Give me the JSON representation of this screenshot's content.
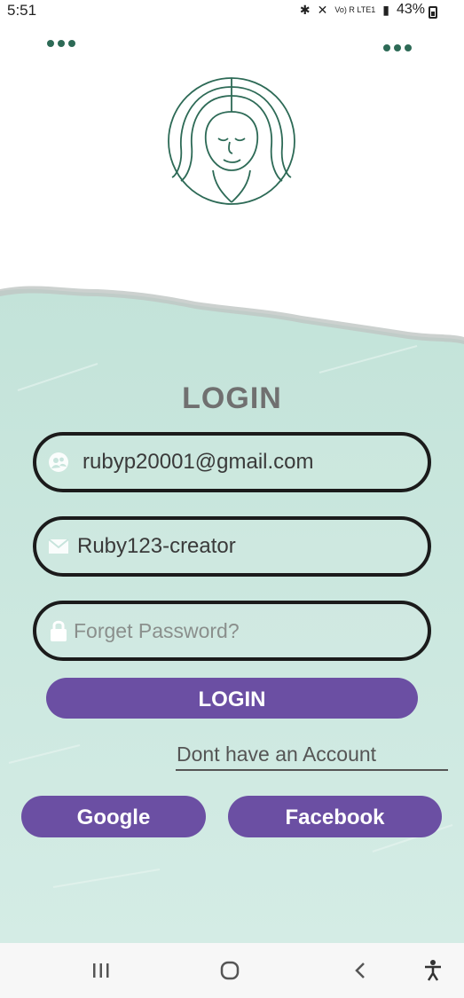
{
  "status_bar": {
    "time": "5:51",
    "battery": "43%",
    "network": "Vo) R LTE1"
  },
  "login": {
    "title": "LOGIN",
    "email": {
      "value": "rubyp20001@gmail.com",
      "icon": "user-icon"
    },
    "username": {
      "value": "Ruby123-creator",
      "icon": "mail-icon"
    },
    "password": {
      "placeholder": "Forget Password?",
      "icon": "lock-icon"
    },
    "login_button": "LOGIN",
    "signup_link": "Dont have an Account",
    "social": {
      "google": "Google",
      "facebook": "Facebook"
    }
  },
  "colors": {
    "accent": "#6b4fa3",
    "mint": "#c7e4dc",
    "logo": "#2d6a56"
  }
}
